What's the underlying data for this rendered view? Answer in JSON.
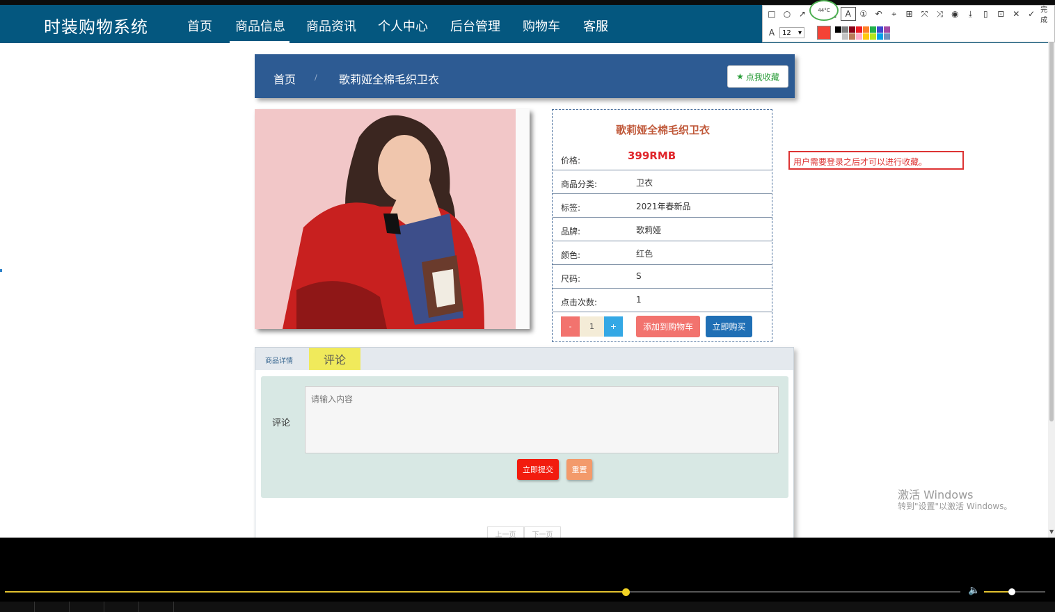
{
  "nav": {
    "brand": "时装购物系统",
    "items": [
      {
        "label": "首页"
      },
      {
        "label": "商品信息"
      },
      {
        "label": "商品资讯"
      },
      {
        "label": "个人中心"
      },
      {
        "label": "后台管理"
      },
      {
        "label": "购物车"
      },
      {
        "label": "客服"
      }
    ],
    "active_index": 1
  },
  "toolbar": {
    "done_label": "完成",
    "font_size": "12",
    "current_color": "#f44336",
    "palette": [
      "#000000",
      "#7f7f7f",
      "#880015",
      "#ed1c24",
      "#ff7f27",
      "#22b14c",
      "#3f48cc",
      "#a349a4",
      "#ffffff",
      "#c3c3c3",
      "#b97a57",
      "#ffaec9",
      "#ffc90e",
      "#b5e61d",
      "#00a2e8",
      "#7092be"
    ],
    "temperature": "44°C"
  },
  "breadcrumb": {
    "home": "首页",
    "separator": "/",
    "current": "歌莉娅全棉毛织卫衣",
    "favorite_label": "点我收藏"
  },
  "product": {
    "title": "歌莉娅全棉毛织卫衣",
    "price_label": "价格:",
    "price": "399RMB",
    "attributes": [
      {
        "label": "商品分类:",
        "value": "卫衣"
      },
      {
        "label": "标签:",
        "value": "2021年春新品"
      },
      {
        "label": "品牌:",
        "value": "歌莉娅"
      },
      {
        "label": "颜色:",
        "value": "红色"
      },
      {
        "label": "尺码:",
        "value": "S"
      },
      {
        "label": "点击次数:",
        "value": "1"
      }
    ],
    "qty_minus": "-",
    "qty": "1",
    "qty_plus": "+",
    "add_to_cart": "添加到购物车",
    "buy_now": "立即购买"
  },
  "note": {
    "text": "用户需要登录之后才可以进行收藏。"
  },
  "tabs": {
    "details": "商品详情",
    "comments": "评论"
  },
  "comment_form": {
    "label": "评论",
    "placeholder": "请输入内容",
    "submit": "立即提交",
    "reset": "重置"
  },
  "pager": {
    "prev": "上一页",
    "next": "下一页"
  },
  "watermark": {
    "title": "激活 Windows",
    "subtitle": "转到\"设置\"以激活 Windows。"
  },
  "player": {
    "progress": 0.65,
    "volume": 0.45
  }
}
